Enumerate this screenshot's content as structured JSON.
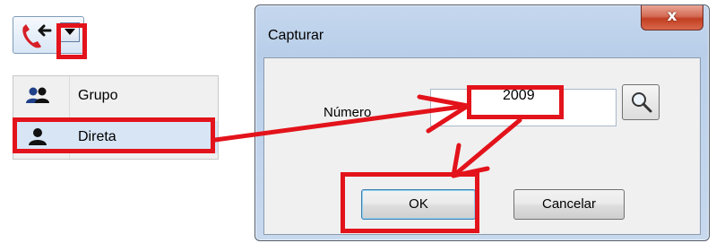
{
  "toolbar": {
    "button_icon": "phone-transfer-icon",
    "dropdown_icon": "chevron-down-icon"
  },
  "menu": {
    "items": [
      {
        "label": "Grupo",
        "icon": "group-icon"
      },
      {
        "label": "Direta",
        "icon": "person-icon"
      }
    ]
  },
  "dialog": {
    "title": "Capturar",
    "close_label": "x",
    "numero_label": "Número",
    "numero_value": "2009",
    "search_icon": "search-icon",
    "ok_label": "OK",
    "cancel_label": "Cancelar"
  },
  "colors": {
    "highlight": "#e3131b",
    "menu_selected": "#d7e5f5",
    "close_button": "#c94a2f"
  }
}
